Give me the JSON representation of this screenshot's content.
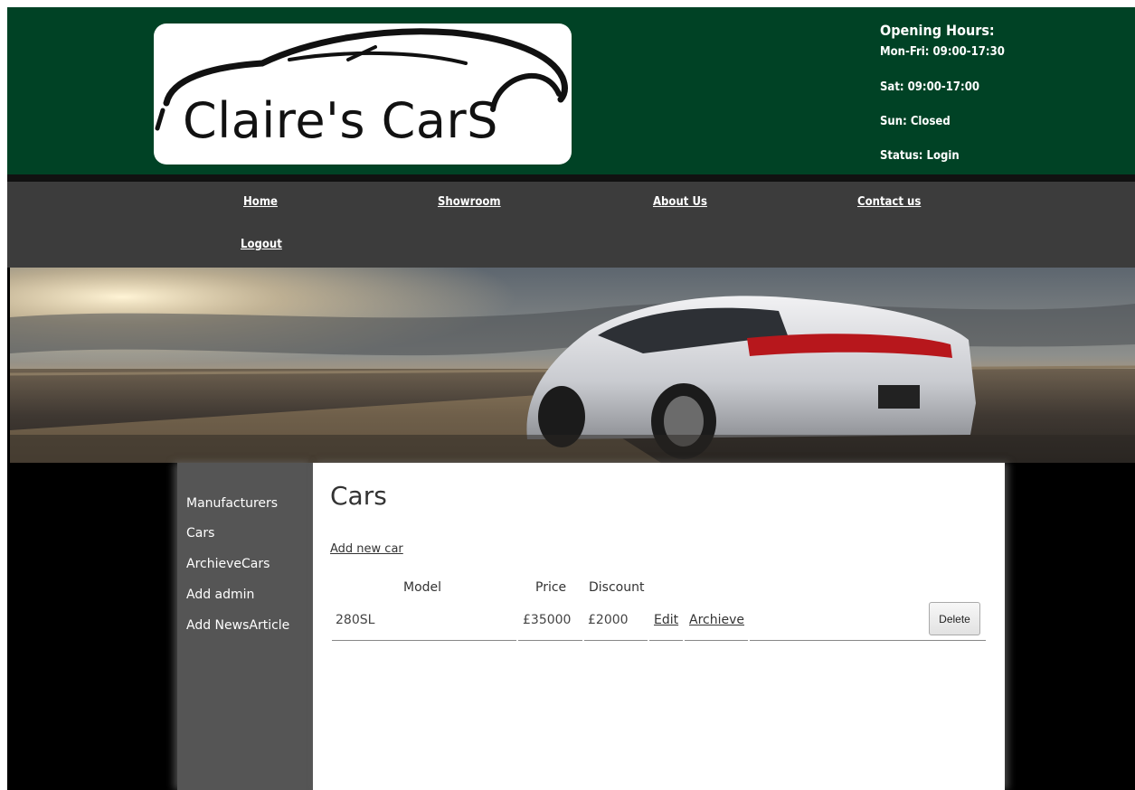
{
  "header": {
    "logo_text": "Claire's CarS",
    "hours_title": "Opening Hours:",
    "hours": [
      "Mon-Fri: 09:00-17:30",
      "Sat: 09:00-17:00",
      "Sun: Closed"
    ],
    "status": "Status: Login"
  },
  "nav": {
    "home": "Home",
    "showroom": "Showroom",
    "about": "About Us",
    "contact": "Contact us",
    "logout": "Logout"
  },
  "sidebar": {
    "items": [
      {
        "label": "Manufacturers"
      },
      {
        "label": "Cars"
      },
      {
        "label": "ArchieveCars"
      },
      {
        "label": "Add admin"
      },
      {
        "label": "Add NewsArticle"
      }
    ]
  },
  "main": {
    "title": "Cars",
    "add_link": "Add new car",
    "columns": {
      "model": "Model",
      "price": "Price",
      "discount": "Discount"
    },
    "rows": [
      {
        "model": "280SL",
        "price": "£35000",
        "discount": "£2000",
        "edit": "Edit",
        "archive": "Archieve",
        "delete": "Delete"
      }
    ]
  },
  "colors": {
    "header_bg": "#004225",
    "nav_bg": "#3c3c3c",
    "sidebar_bg": "#555555",
    "page_bg": "#000000"
  }
}
